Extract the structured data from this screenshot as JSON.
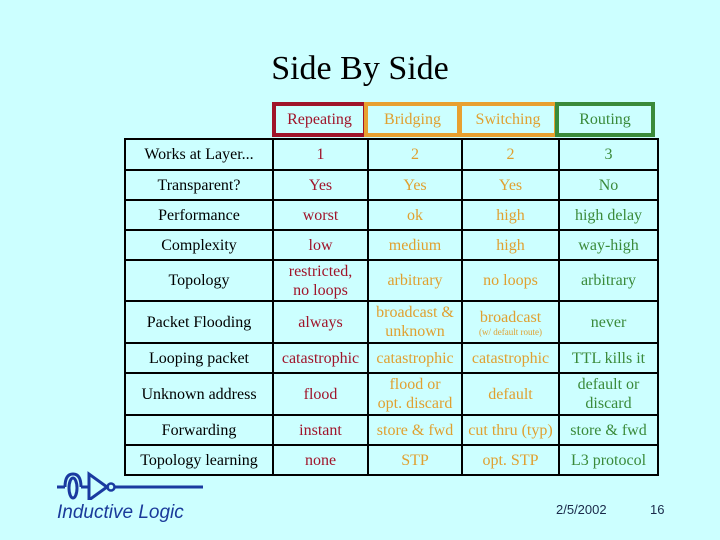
{
  "slide": {
    "title": "Side By Side",
    "date": "2/5/2002",
    "page_number": "16",
    "logo_text": "Inductive Logic"
  },
  "colors": {
    "background": "#ccffff",
    "repeating": "#a0142a",
    "bridging": "#e0a030",
    "switching": "#e0a030",
    "routing": "#3a8a3a"
  },
  "table": {
    "columns": [
      "Repeating",
      "Bridging",
      "Switching",
      "Routing"
    ],
    "rows": [
      {
        "label": "Works at Layer...",
        "cells": [
          "1",
          "2",
          "2",
          "3"
        ]
      },
      {
        "label": "Transparent?",
        "cells": [
          "Yes",
          "Yes",
          "Yes",
          "No"
        ]
      },
      {
        "label": "Performance",
        "cells": [
          "worst",
          "ok",
          "high",
          "high delay"
        ]
      },
      {
        "label": "Complexity",
        "cells": [
          "low",
          "medium",
          "high",
          "way-high"
        ]
      },
      {
        "label": "Topology",
        "cells": [
          "restricted,",
          "arbitrary",
          "no loops",
          "arbitrary"
        ],
        "extra": {
          "c1_line2": "no loops"
        }
      },
      {
        "label": "Packet Flooding",
        "cells": [
          "always",
          "broadcast &",
          "broadcast",
          "never"
        ],
        "extra": {
          "c2_line2": "unknown",
          "c3_note": "(w/ default route)"
        }
      },
      {
        "label": "Looping packet",
        "cells": [
          "catastrophic",
          "catastrophic",
          "catastrophic",
          "TTL kills it"
        ]
      },
      {
        "label": "Unknown address",
        "cells": [
          "flood",
          "flood or",
          "default",
          "default or"
        ],
        "extra": {
          "c2_line2": "opt. discard",
          "c4_line2": "discard"
        }
      },
      {
        "label": "Forwarding",
        "cells": [
          "instant",
          "store & fwd",
          "cut thru (typ)",
          "store & fwd"
        ]
      },
      {
        "label": "Topology learning",
        "cells": [
          "none",
          "STP",
          "opt. STP",
          "L3 protocol"
        ]
      }
    ]
  }
}
